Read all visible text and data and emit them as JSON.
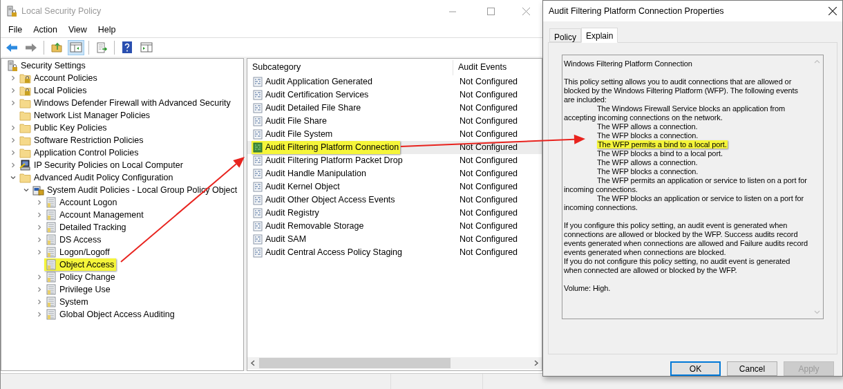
{
  "window": {
    "title": "Local Security Policy"
  },
  "menu": [
    "File",
    "Action",
    "View",
    "Help"
  ],
  "toolbar": [
    {
      "kind": "back",
      "pressed": false
    },
    {
      "kind": "forward",
      "pressed": false
    },
    {
      "kind": "separator"
    },
    {
      "kind": "up",
      "pressed": false
    },
    {
      "kind": "tree",
      "pressed": true
    },
    {
      "kind": "separator"
    },
    {
      "kind": "export",
      "pressed": false
    },
    {
      "kind": "separator"
    },
    {
      "kind": "help",
      "pressed": false
    },
    {
      "kind": "action",
      "pressed": false
    }
  ],
  "tree": [
    {
      "label": "Security Settings",
      "kind": "root",
      "selected": false,
      "children": [
        {
          "label": "Account Policies",
          "kind": "lockfolder",
          "expanded": false,
          "selected": false
        },
        {
          "label": "Local Policies",
          "kind": "lockfolder",
          "expanded": false,
          "selected": false
        },
        {
          "label": "Windows Defender Firewall with Advanced Security",
          "kind": "folder",
          "expanded": false,
          "selected": false
        },
        {
          "label": "Network List Manager Policies",
          "kind": "folder",
          "selected": false
        },
        {
          "label": "Public Key Policies",
          "kind": "folder",
          "expanded": false,
          "selected": false
        },
        {
          "label": "Software Restriction Policies",
          "kind": "folder",
          "expanded": false,
          "selected": false
        },
        {
          "label": "Application Control Policies",
          "kind": "folder",
          "expanded": false,
          "selected": false
        },
        {
          "label": "IP Security Policies on Local Computer",
          "kind": "ipsec",
          "expanded": false,
          "selected": false
        },
        {
          "label": "Advanced Audit Policy Configuration",
          "kind": "folder",
          "expanded": true,
          "selected": false,
          "children": [
            {
              "label": "System Audit Policies - Local Group Policy Object",
              "kind": "gpo",
              "expanded": true,
              "selected": false,
              "children": [
                {
                  "label": "Account Logon",
                  "kind": "policy",
                  "expanded": false,
                  "selected": false
                },
                {
                  "label": "Account Management",
                  "kind": "policy",
                  "expanded": false,
                  "selected": false
                },
                {
                  "label": "Detailed Tracking",
                  "kind": "policy",
                  "expanded": false,
                  "selected": false
                },
                {
                  "label": "DS Access",
                  "kind": "policy",
                  "expanded": false,
                  "selected": false
                },
                {
                  "label": "Logon/Logoff",
                  "kind": "policy",
                  "expanded": false,
                  "selected": false
                },
                {
                  "label": "Object Access",
                  "kind": "policy",
                  "selected": true
                },
                {
                  "label": "Policy Change",
                  "kind": "policy",
                  "expanded": false,
                  "selected": false
                },
                {
                  "label": "Privilege Use",
                  "kind": "policy",
                  "expanded": false,
                  "selected": false
                },
                {
                  "label": "System",
                  "kind": "policy",
                  "expanded": false,
                  "selected": false
                },
                {
                  "label": "Global Object Access Auditing",
                  "kind": "policy",
                  "expanded": false,
                  "selected": false
                }
              ]
            }
          ]
        }
      ]
    }
  ],
  "list": {
    "columns": [
      "Subcategory",
      "Audit Events"
    ],
    "rows": [
      {
        "subcategory": "Audit Application Generated",
        "audit_events": "Not Configured",
        "selected": false
      },
      {
        "subcategory": "Audit Certification Services",
        "audit_events": "Not Configured",
        "selected": false
      },
      {
        "subcategory": "Audit Detailed File Share",
        "audit_events": "Not Configured",
        "selected": false
      },
      {
        "subcategory": "Audit File Share",
        "audit_events": "Not Configured",
        "selected": false
      },
      {
        "subcategory": "Audit File System",
        "audit_events": "Not Configured",
        "selected": false
      },
      {
        "subcategory": "Audit Filtering Platform Connection",
        "audit_events": "Not Configured",
        "selected": true
      },
      {
        "subcategory": "Audit Filtering Platform Packet Drop",
        "audit_events": "Not Configured",
        "selected": false
      },
      {
        "subcategory": "Audit Handle Manipulation",
        "audit_events": "Not Configured",
        "selected": false
      },
      {
        "subcategory": "Audit Kernel Object",
        "audit_events": "Not Configured",
        "selected": false
      },
      {
        "subcategory": "Audit Other Object Access Events",
        "audit_events": "Not Configured",
        "selected": false
      },
      {
        "subcategory": "Audit Registry",
        "audit_events": "Not Configured",
        "selected": false
      },
      {
        "subcategory": "Audit Removable Storage",
        "audit_events": "Not Configured",
        "selected": false
      },
      {
        "subcategory": "Audit SAM",
        "audit_events": "Not Configured",
        "selected": false
      },
      {
        "subcategory": "Audit Central Access Policy Staging",
        "audit_events": "Not Configured",
        "selected": false
      }
    ]
  },
  "dialog": {
    "title": "Audit Filtering Platform Connection Properties",
    "tabs": [
      {
        "label": "Policy",
        "selected": false
      },
      {
        "label": "Explain",
        "selected": true
      }
    ],
    "explain": {
      "title": "Windows Filtering Platform Connection",
      "blocks": [
        {
          "kind": "paragraph",
          "text": "This policy setting allows you to audit connections that are allowed or blocked by the Windows Filtering Platform (WFP). The following events are included:"
        },
        {
          "kind": "event",
          "text": "The Windows Firewall Service blocks an application from accepting incoming connections on the network.",
          "highlighted": false
        },
        {
          "kind": "event",
          "text": "The WFP allows a connection.",
          "highlighted": false
        },
        {
          "kind": "event",
          "text": "The WFP blocks a connection.",
          "highlighted": false
        },
        {
          "kind": "event",
          "text": "The WFP permits a bind to a local port.",
          "highlighted": true
        },
        {
          "kind": "event",
          "text": "The WFP blocks a bind to a local port.",
          "highlighted": false
        },
        {
          "kind": "event",
          "text": "The WFP allows a connection.",
          "highlighted": false
        },
        {
          "kind": "event",
          "text": "The WFP blocks a connection.",
          "highlighted": false
        },
        {
          "kind": "event",
          "text": "The WFP permits an application or service to listen on a port for incoming connections.",
          "highlighted": false
        },
        {
          "kind": "event",
          "text": "The WFP blocks an application or service to listen on a port for incoming connections.",
          "highlighted": false
        },
        {
          "kind": "paragraph",
          "text": "If you configure this policy setting, an audit event is generated when connections are allowed or blocked by the WFP. Success audits record events generated when connections are allowed and Failure audits record events generated when connections are blocked."
        },
        {
          "kind": "line",
          "text": "If you do not configure this policy setting, no audit event is generated when connected are allowed or blocked by the WFP."
        },
        {
          "kind": "paragraph",
          "text": "Volume: High."
        }
      ]
    },
    "buttons": [
      {
        "label": "OK",
        "default": true,
        "disabled": false
      },
      {
        "label": "Cancel",
        "default": false,
        "disabled": false
      },
      {
        "label": "Apply",
        "default": false,
        "disabled": true
      }
    ]
  }
}
